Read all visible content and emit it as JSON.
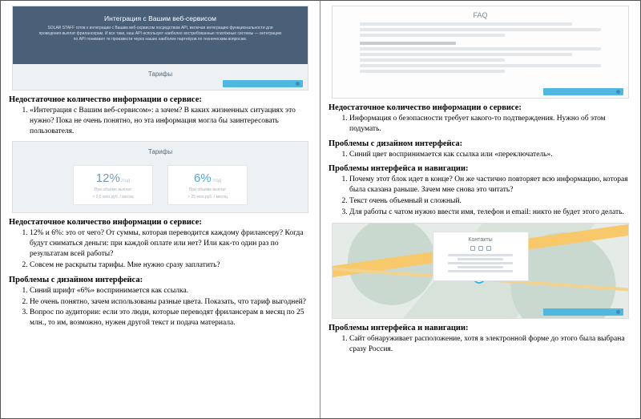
{
  "left": {
    "mock1": {
      "hero_title": "Интеграция с Вашим веб-сервисом",
      "hero_sub": "SOLAR STAFF готов к интеграции с Вашим веб-сервисом посредством API, включая интеграцию функциональности для проведения выплат фрилансерам. И все таки, наш API использует наиболее востребованные платёжные системы — интеграцию по API понимают те произвести через наших наиболее партнёров по техническим вопросам.",
      "tariff_label": "Тарифы"
    },
    "block1": {
      "title": "Недостаточное количество информации о сервисе:",
      "items": [
        "«Интеграция с Вашим веб-сервисом»: а зачем? В каких жизненных ситуациях это нужно? Пока не очень понятно, но эта информация могла бы заинтересовать пользователя."
      ]
    },
    "mock2": {
      "tariff_label": "Тарифы",
      "price1": {
        "val": "12%",
        "unit": "/год",
        "sub1": "При объёме выплат",
        "sub2": "> 0,5 млн.руб. / месяц"
      },
      "price2": {
        "val": "6%",
        "unit": "/год",
        "sub1": "При объёме выплат",
        "sub2": "> 25 млн.руб. / месяц"
      }
    },
    "block2": {
      "title": "Недостаточное количество информации о сервисе:",
      "items": [
        "12% и 6%: это от чего? От суммы, которая переводится каждому фрилансеру? Когда будут сниматься деньги: при каждой оплате или нет? Или как-то один раз по результатам всей работы?",
        "Совсем не раскрыты тарифы. Мне нужно сразу заплатить?"
      ]
    },
    "block3": {
      "title": "Проблемы с дизайном интерфейса:",
      "items": [
        "Синий шрифт «6%» воспринимается как ссылка.",
        "Не очень понятно, зачем использованы разные цвета. Показать, что тариф выгодней?",
        "Вопрос по аудитории: если это люди, которые переводят фрилансерам в месяц по 25 млн., то им, возможно, нужен другой текст и подача материала."
      ]
    }
  },
  "right": {
    "mock3": {
      "faq_title": "FAQ"
    },
    "block1": {
      "title": "Недостаточное количество информации о сервисе:",
      "items": [
        "Информация о безопасности требует какого-то подтверждения. Нужно об этом подумать."
      ]
    },
    "block2": {
      "title": "Проблемы с дизайном интерфейса:",
      "items": [
        "Синий цвет воспринимается как ссылка или «переключатель»."
      ]
    },
    "block3": {
      "title": "Проблемы интерфейса и навигации:",
      "items": [
        "Почему этот блок идет в конце? Он же частично повторяет всю информацию, которая была сказана раньше. Зачем мне снова это читать?",
        "Текст очень объемный и сложный.",
        "Для работы с чатом нужно ввести имя, телефон и email: никто не будет этого делать."
      ]
    },
    "mock4": {
      "card_title": "Контакты"
    },
    "block4": {
      "title": "Проблемы интерфейса и навигации:",
      "items": [
        "Сайт обнаруживает расположение, хотя в электронной форме до этого была выбрана сразу Россия."
      ]
    }
  }
}
